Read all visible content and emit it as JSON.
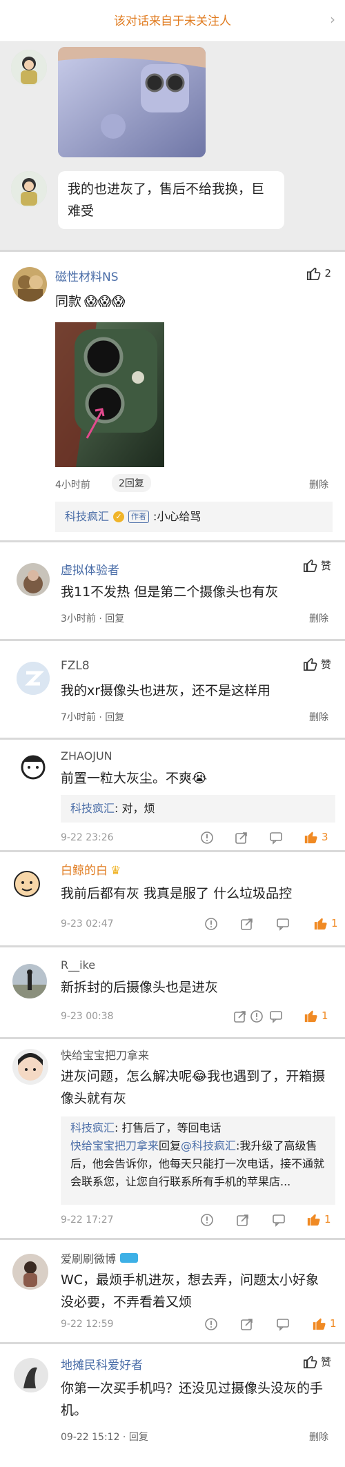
{
  "chat": {
    "header": "该对话来自于未关注人",
    "message_text": "我的也进灰了，售后不给我换，巨难受"
  },
  "comments": [
    {
      "user": "磁性材料NS",
      "likes": "2",
      "text": "同款",
      "emoji": "😱😱😱",
      "time": "4小时前",
      "replies_button": "2回复",
      "delete": "删除",
      "quote_user": "科技疯汇",
      "quote_badge": "作者",
      "quote_text": ":小心给骂"
    },
    {
      "user": "虚拟体验者",
      "like_label": "赞",
      "text": "我11不发热 但是第二个摄像头也有灰",
      "time": "3小时前 · 回复",
      "delete": "删除"
    },
    {
      "user": "FZL8",
      "like_label": "赞",
      "text": "我的xr摄像头也进灰，还不是这样用",
      "time": "7小时前 · 回复",
      "delete": "删除"
    },
    {
      "user": "ZHAOJUN",
      "text": "前置一粒大灰尘。不爽",
      "emoji": "😭",
      "quote_user": "科技疯汇",
      "quote_text": ": 对，烦",
      "time": "9-22 23:26",
      "likes": "3"
    },
    {
      "user": "白鲸的白",
      "text": "我前后都有灰 我真是服了 什么垃圾品控",
      "time": "9-23 02:47",
      "likes": "1"
    },
    {
      "user": "R__ike",
      "text": "新拆封的后摄像头也是进灰",
      "time": "9-23 00:38",
      "likes": "1"
    },
    {
      "user": "快给宝宝把刀拿来",
      "text_a": "进灰问题，怎么解决呢",
      "emoji": "😂",
      "text_b": "我也遇到了，开箱摄像头就有灰",
      "q1_user": "科技疯汇",
      "q1_text": ": 打售后了，等回电话",
      "q2_user": "快给宝宝把刀拿来",
      "q2_mid": "回复",
      "q2_at": "@科技疯汇",
      "q2_text": ":我升级了高级售后，他会告诉你，他每天只能打一次电话，接不通就会联系您，让您自行联系所有手机的苹果店...",
      "time": "9-22 17:27",
      "likes": "1"
    },
    {
      "user": "爱刷刷微博",
      "text": "WC，最烦手机进灰，想去弄，问题太小好象没必要，不弄看着又烦",
      "time": "9-22 12:59",
      "likes": "1"
    },
    {
      "user": "地摊民科爱好者",
      "like_label": "赞",
      "text": "你第一次买手机吗？还没见过摄像头没灰的手机。",
      "time": "09-22 15:12 · 回复",
      "delete": "删除"
    }
  ],
  "colors": {
    "link": "#4b6ea8",
    "like_orange": "#f08a24",
    "arrow_pink": "#e34a8e"
  }
}
